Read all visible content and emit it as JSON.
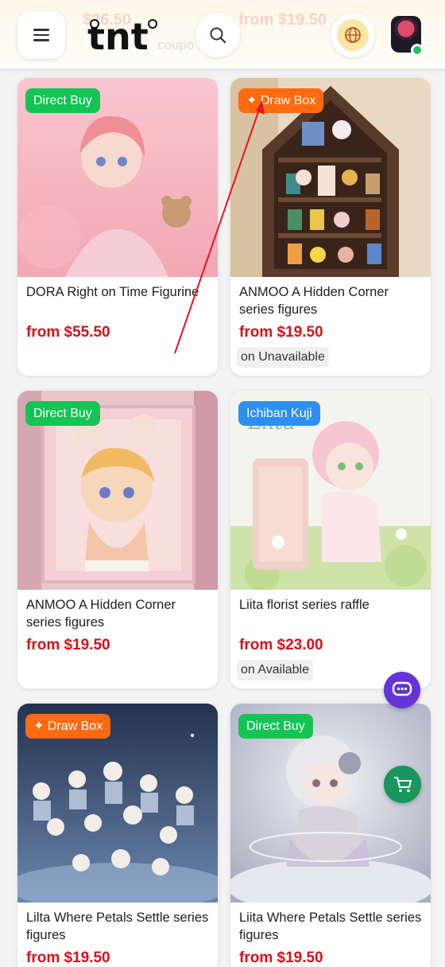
{
  "header": {
    "ghost_price_left": "$26.50",
    "ghost_price_right": "from $19.50",
    "ghost_text": "coupo",
    "logo_text": "tnt",
    "icons": {
      "menu": "hamburger-menu-icon",
      "search": "search-icon",
      "language": "globe-icon",
      "account": "user-avatar"
    }
  },
  "products": [
    {
      "badge": "Direct Buy",
      "badge_color": "#14c455",
      "title": "DORA Right on Time Figurine",
      "price": "from $55.50",
      "availability": ""
    },
    {
      "badge": "✦ Draw Box",
      "badge_color": "#ff6a10",
      "title": "ANMOO A Hidden Corner series figures",
      "price": "from $19.50",
      "availability": "on Unavailable"
    },
    {
      "badge": "Direct Buy",
      "badge_color": "#14c455",
      "title": "ANMOO A Hidden Corner series figures",
      "price": "from $19.50",
      "availability": ""
    },
    {
      "badge": "Ichiban Kuji",
      "badge_color": "#2e8ff0",
      "title": "Liita florist series raffle",
      "price": "from $23.00",
      "availability": "on Available"
    },
    {
      "badge": "✦ Draw Box",
      "badge_color": "#ff6a10",
      "title": "Lilta Where Petals Settle series figures",
      "price": "from $19.50",
      "availability": ""
    },
    {
      "badge": "Direct Buy",
      "badge_color": "#14c455",
      "title": "Liita Where Petals Settle series figures",
      "price": "from $19.50",
      "availability": ""
    }
  ],
  "fabs": {
    "chat": "chat-bubble-icon",
    "cart": "shopping-cart-icon"
  },
  "colors": {
    "price": "#d4121a",
    "direct_buy": "#14c455",
    "draw_box": "#ff6a10",
    "ichiban_kuji": "#2e8ff0",
    "chat_fab": "#6335d6",
    "cart_fab": "#17965e",
    "annotation_arrow": "#e8141c"
  }
}
